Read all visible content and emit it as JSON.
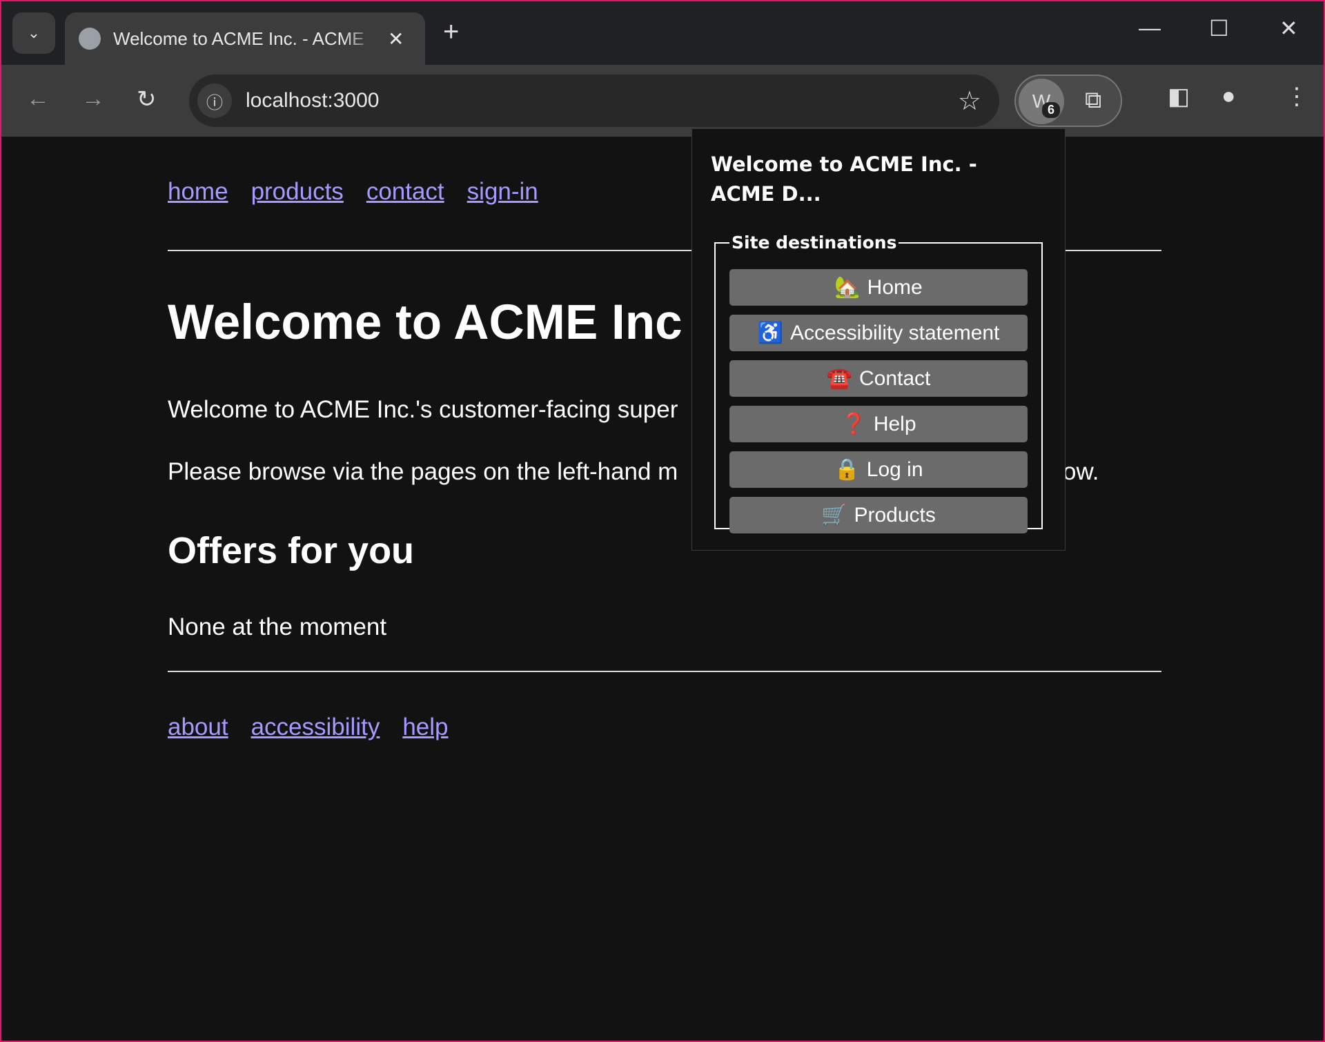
{
  "browser": {
    "tab_title": "Welcome to ACME Inc. - ACME",
    "url": "localhost:3000",
    "extension_letter": "W",
    "extension_badge": "6"
  },
  "page": {
    "top_nav": [
      "home",
      "products",
      "contact",
      "sign-in"
    ],
    "heading": "Welcome to ACME Inc",
    "para1_visible": "Welcome to ACME Inc.'s customer-facing super",
    "para2_visible": "Please browse via the pages on the left-hand m",
    "para2_tail": "ow.",
    "offers_heading": "Offers for you",
    "offers_text": "None at the moment",
    "footer_nav": [
      "about",
      "accessibility",
      "help"
    ],
    "link_color": "#a59bff"
  },
  "popup": {
    "title": "Welcome to ACME Inc. - ACME D...",
    "legend": "Site destinations",
    "buttons": [
      {
        "label": "Home",
        "icon": "🏡",
        "icon_name": "house-icon"
      },
      {
        "label": "Accessibility statement",
        "icon": "♿",
        "icon_name": "wheelchair-icon"
      },
      {
        "label": "Contact",
        "icon": "☎️",
        "icon_name": "telephone-icon"
      },
      {
        "label": "Help",
        "icon": "❓",
        "icon_name": "question-mark-icon"
      },
      {
        "label": "Log in",
        "icon": "🔒",
        "icon_name": "lock-icon"
      },
      {
        "label": "Products",
        "icon": "🛒",
        "icon_name": "shopping-cart-icon"
      }
    ]
  }
}
